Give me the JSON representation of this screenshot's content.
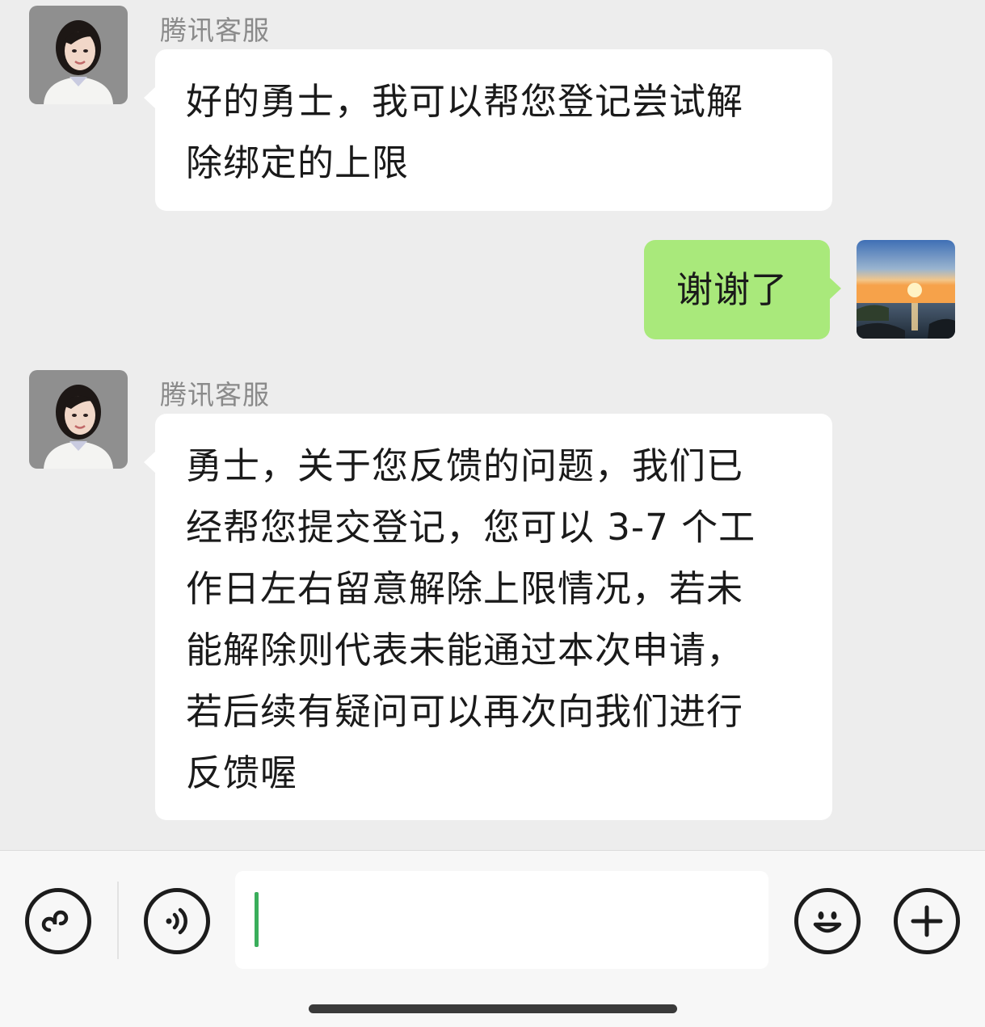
{
  "messages": [
    {
      "direction": "incoming",
      "sender": "腾讯客服",
      "text": "好的勇士，我可以帮您登记尝试解\n除绑定的上限"
    },
    {
      "direction": "outgoing",
      "text": "谢谢了"
    },
    {
      "direction": "incoming",
      "sender": "腾讯客服",
      "text": "勇士，关于您反馈的问题，我们已\n经帮您提交登记，您可以 3-7 个工\n作日左右留意解除上限情况，若未\n能解除则代表未能通过本次申请，\n若后续有疑问可以再次向我们进行\n反馈喔"
    }
  ],
  "toolbar": {
    "left_icons": [
      "mini-program-icon",
      "voice-icon"
    ],
    "input_value": "",
    "right_icons": [
      "emoji-icon",
      "plus-icon"
    ]
  },
  "colors": {
    "background": "#ededed",
    "incoming_bubble": "#ffffff",
    "outgoing_bubble": "#a9e97b",
    "caret": "#3aae5b"
  }
}
